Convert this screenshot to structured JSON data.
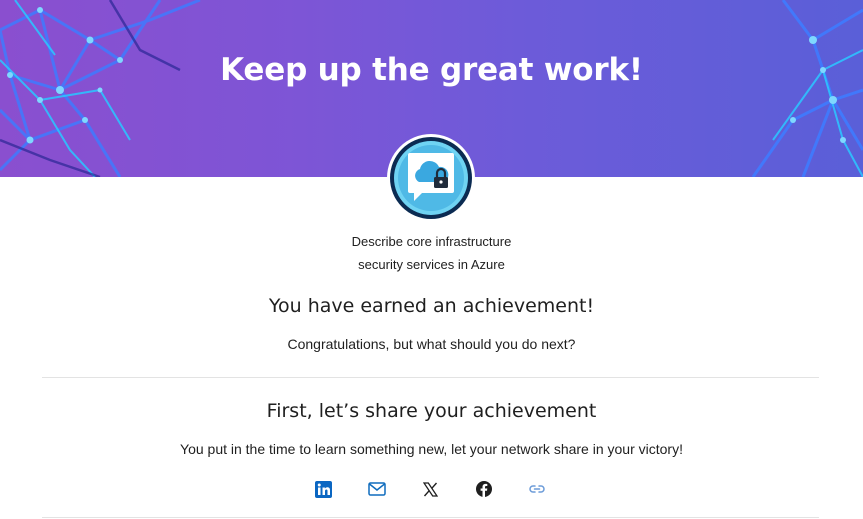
{
  "hero": {
    "title": "Keep up the great work!"
  },
  "badge": {
    "icon": "cloud-lock-badge-icon",
    "title_line1": "Describe core infrastructure",
    "title_line2": "security services in Azure"
  },
  "achievement": {
    "heading": "You have earned an achievement!",
    "subtext": "Congratulations, but what should you do next?"
  },
  "share": {
    "heading": "First, let’s share your achievement",
    "subtext": "You put in the time to learn something new, let your network share in your victory!",
    "buttons": [
      {
        "icon": "linkedin-icon",
        "color": "#0a66c2"
      },
      {
        "icon": "email-icon",
        "color": "#0f6cbd"
      },
      {
        "icon": "x-twitter-icon",
        "color": "#1f1f1f"
      },
      {
        "icon": "facebook-icon",
        "color": "#1f1f1f"
      },
      {
        "icon": "copy-link-icon",
        "color": "#6b9bd8"
      }
    ]
  },
  "colors": {
    "hero_gradient_start": "#8a4fcf",
    "hero_gradient_end": "#5a5fd8",
    "accent": "#0f6cbd"
  }
}
